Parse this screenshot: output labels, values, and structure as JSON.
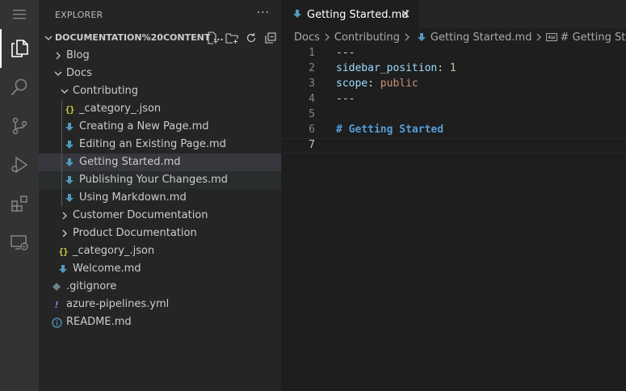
{
  "activity_bar": {
    "items": [
      {
        "name": "explorer",
        "icon": "files-icon",
        "active": true
      },
      {
        "name": "search",
        "icon": "search-icon"
      },
      {
        "name": "source-control",
        "icon": "source-control-icon"
      },
      {
        "name": "run-debug",
        "icon": "run-debug-icon"
      },
      {
        "name": "extensions",
        "icon": "extensions-icon"
      },
      {
        "name": "remote-explorer",
        "icon": "remote-explorer-icon"
      }
    ]
  },
  "sidebar": {
    "title": "EXPLORER",
    "more_label": "···",
    "section": {
      "title": "DOCUMENTATION%20CONTENT ...",
      "actions": [
        "new-file-icon",
        "new-folder-icon",
        "refresh-icon",
        "collapse-all-icon"
      ]
    },
    "tree": [
      {
        "label": "Blog",
        "kind": "folder",
        "expanded": false
      },
      {
        "label": "Docs",
        "kind": "folder",
        "expanded": true
      },
      {
        "label": "Contributing",
        "kind": "folder",
        "expanded": true
      },
      {
        "label": "_category_.json",
        "kind": "json"
      },
      {
        "label": "Creating a New Page.md",
        "kind": "md"
      },
      {
        "label": "Editing an Existing Page.md",
        "kind": "md"
      },
      {
        "label": "Getting Started.md",
        "kind": "md",
        "selected": true
      },
      {
        "label": "Publishing Your Changes.md",
        "kind": "md"
      },
      {
        "label": "Using Markdown.md",
        "kind": "md"
      },
      {
        "label": "Customer Documentation",
        "kind": "folder",
        "expanded": false
      },
      {
        "label": "Product Documentation",
        "kind": "folder",
        "expanded": false
      },
      {
        "label": "_category_.json",
        "kind": "json"
      },
      {
        "label": "Welcome.md",
        "kind": "md"
      },
      {
        "label": ".gitignore",
        "kind": "git"
      },
      {
        "label": "azure-pipelines.yml",
        "kind": "yml"
      },
      {
        "label": "README.md",
        "kind": "info"
      }
    ]
  },
  "editor": {
    "tab": {
      "label": "Getting Started.md",
      "close": "×"
    },
    "breadcrumb": [
      "Docs",
      "Contributing",
      "Getting Started.md",
      "# Getting Started"
    ],
    "lines": [
      {
        "num": "1",
        "tokens": [
          {
            "t": "---",
            "c": "plain"
          }
        ]
      },
      {
        "num": "2",
        "tokens": [
          {
            "t": "sidebar_position",
            "c": "key"
          },
          {
            "t": ": ",
            "c": "plain"
          },
          {
            "t": "1",
            "c": "num"
          }
        ]
      },
      {
        "num": "3",
        "tokens": [
          {
            "t": "scope",
            "c": "key"
          },
          {
            "t": ": ",
            "c": "plain"
          },
          {
            "t": "public",
            "c": "str"
          }
        ]
      },
      {
        "num": "4",
        "tokens": [
          {
            "t": "---",
            "c": "plain"
          }
        ]
      },
      {
        "num": "5",
        "tokens": []
      },
      {
        "num": "6",
        "tokens": [
          {
            "t": "# Getting Started",
            "c": "head"
          }
        ]
      },
      {
        "num": "7",
        "tokens": [],
        "current": true
      }
    ]
  },
  "colors": {
    "activity_bar": "#333333",
    "sidebar": "#252526",
    "editor": "#1e1e1e",
    "selection": "#37373d",
    "md_icon": "#519aba",
    "json_icon": "#cbcb41"
  }
}
